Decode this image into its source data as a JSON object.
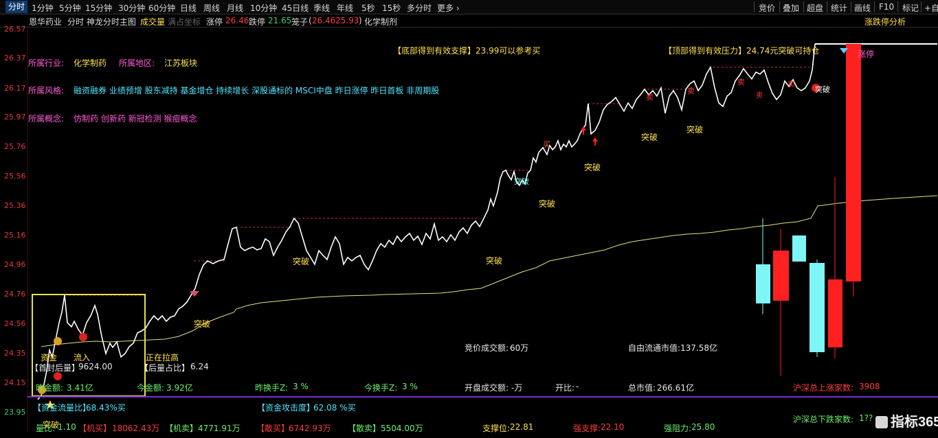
{
  "topbar": {
    "tabs": [
      "分时",
      "1分钟",
      "5分钟",
      "15分钟",
      "30分钟",
      "60分钟",
      "日线",
      "周线",
      "月线",
      "10分钟",
      "45日线",
      "季线",
      "年线",
      "5秒",
      "15秒",
      "多分时",
      "更多 ›"
    ],
    "right_tabs": [
      "竞价",
      "叠加",
      "超盘",
      "统计",
      "画线",
      "F10",
      "标记",
      "+自"
    ]
  },
  "infobar": {
    "stock_name": "恩华药业",
    "view": "分时 神龙分时主图",
    "volume_label": "成交量",
    "fullscreen_label": "满占坐标",
    "limit_up_label": "涨停",
    "limit_up_value": "26.46",
    "limit_down_label": "跌停",
    "limit_down_value": "21.65",
    "cage_label": "笼子",
    "cage_value_1": "26.46",
    "cage_value_2": "25.93",
    "industry": "化学制剂",
    "right_button": "涨跌停分析"
  },
  "price_axis": [
    "26.57",
    "26.37",
    "26.17",
    "25.97",
    "25.76",
    "25.56",
    "25.36",
    "25.16",
    "24.96",
    "24.76",
    "24.56",
    "24.35",
    "24.15",
    "23.95"
  ],
  "info_rows": {
    "industry_label": "所属行业:",
    "industry_value": "化学制药",
    "region_label": "所属地区:",
    "region_value": "江苏板块",
    "style_label": "所属风格:",
    "style_value": "融资融券 业绩预增 股东减持 基金增仓 持续增长 深股通标的 MSCI中盘 昨日涨停 昨日首板 非周期股",
    "concept_label": "所属概念:",
    "concept_value": "仿制药 创新药 新冠检测 猴痘概念"
  },
  "banners": {
    "support": "【底部得到有效支撑】23.99可以参考买",
    "resistance": "【顶部得到有效压力】24.74元突破可持仓",
    "limit_up_flag": "涨停"
  },
  "annotations": {
    "breakouts": [
      "突破",
      "突破",
      "突破",
      "突破",
      "突破",
      "突破",
      "突破",
      "突破",
      "突破"
    ],
    "buy": "买",
    "sell_labels": [
      "卖",
      "卖",
      "卖",
      "卖",
      "卖"
    ],
    "breakout_bottom": "突破",
    "fund": "资金",
    "inflow": "流入",
    "pulling": "正在拉高"
  },
  "stats": {
    "first_seal_label": "【首封后量】",
    "first_seal_value": "9624.00",
    "after_ratio_label": "【后量占比】",
    "after_ratio_value": "6.24",
    "bid_amount_label": "竞价成交额:",
    "bid_amount_value": "60万",
    "float_cap_label": "自由流通市值:",
    "float_cap_value": "137.58亿",
    "yesterday_amount_label": "昨金额:",
    "yesterday_amount_value": "3.41亿",
    "today_amount_label": "今金额:",
    "today_amount_value": "3.92亿",
    "yesterday_turnover_label": "昨换手Z:",
    "yesterday_turnover_value": "3 %",
    "today_turnover_label": "今换手Z:",
    "today_turnover_value": "3 %",
    "open_amount_label": "开盘成交额:",
    "open_amount_value": "-万",
    "open_ratio_label": "开比:",
    "open_ratio_value": "-",
    "total_cap_label": "总市值:",
    "total_cap_value": "266.61亿",
    "sh_sz_up_label": "沪深总上涨家数:",
    "sh_sz_up_value": "3908",
    "fund_flow_label": "【资金流量比】",
    "fund_flow_value": "68.43%买",
    "fund_attack_label": "【资金攻击度】",
    "fund_attack_value": "62.08 %买",
    "sh_sz_down_label": "沪深总下跌家数:",
    "sh_sz_down_value": "1??",
    "volume_ratio_label": "量比:",
    "volume_ratio_value": "1.10",
    "inst_buy_label": "【机买】",
    "inst_buy_value": "18062.43万",
    "inst_sell_label": "【机卖】",
    "inst_sell_value": "4771.91万",
    "retail_buy_label": "【散买】",
    "retail_buy_value": "6742.93万",
    "retail_sell_label": "【散卖】",
    "retail_sell_value": "5504.00万",
    "support_label": "支撑位:",
    "support_value": "22.81",
    "strong_support_label": "强支撑:",
    "strong_support_value": "22.10",
    "strong_resist_label": "强阻力:",
    "strong_resist_value": "25.80"
  },
  "watermark": "指标365",
  "colors": {
    "price_line": "#ffffff",
    "avg_line": "#e6e27a",
    "limit_up": "#ff2020",
    "cyan_candle": "#7ff6f6",
    "divider": "#7a2ad6",
    "box": "#e8e24a"
  }
}
